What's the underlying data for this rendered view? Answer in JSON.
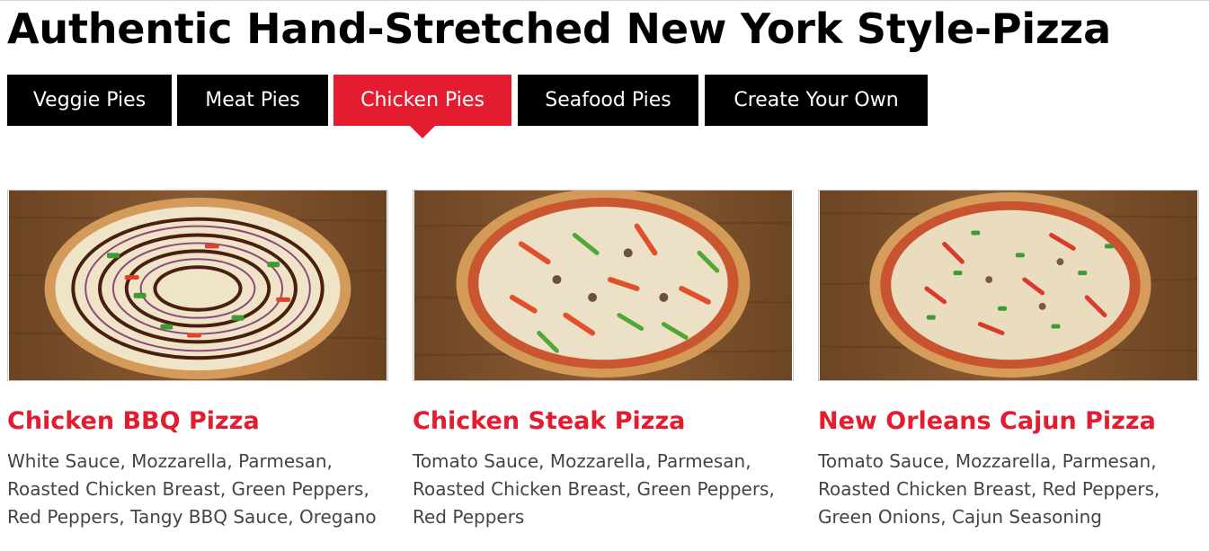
{
  "page": {
    "title": "Authentic Hand-Stretched New York Style-Pizza"
  },
  "tabs": [
    {
      "label": "Veggie Pies",
      "active": false
    },
    {
      "label": "Meat Pies",
      "active": false
    },
    {
      "label": "Chicken Pies",
      "active": true
    },
    {
      "label": "Seafood Pies",
      "active": false
    },
    {
      "label": "Create Your Own",
      "active": false
    }
  ],
  "colors": {
    "accent": "#e31c2f",
    "tab_bg": "#000000",
    "tab_text": "#ffffff",
    "body_text": "#444444"
  },
  "pizzas": [
    {
      "name": "Chicken BBQ Pizza",
      "description": "White Sauce, Mozzarella, Parmesan, Roasted Chicken Breast, Green Peppers, Red Peppers, Tangy BBQ Sauce, Oregano",
      "image_icon": "chicken-bbq-pizza-photo"
    },
    {
      "name": "Chicken Steak Pizza",
      "description": "Tomato Sauce, Mozzarella, Parmesan, Roasted Chicken Breast, Green Peppers, Red Peppers",
      "image_icon": "chicken-steak-pizza-photo"
    },
    {
      "name": "New Orleans Cajun Pizza",
      "description": "Tomato Sauce, Mozzarella, Parmesan, Roasted Chicken Breast, Red Peppers, Green Onions, Cajun Seasoning",
      "image_icon": "cajun-pizza-photo"
    }
  ]
}
